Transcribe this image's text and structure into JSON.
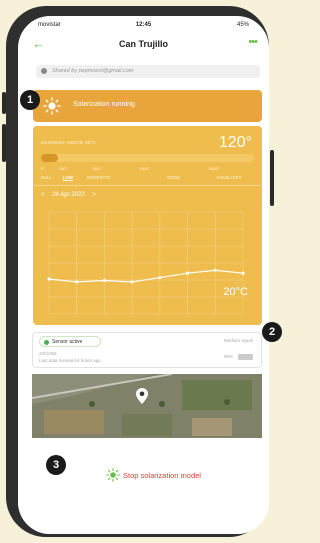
{
  "status_bar": {
    "carrier": "movistar",
    "time": "12:45",
    "battery": "45%"
  },
  "header": {
    "title": "Can Trujillo"
  },
  "shared": {
    "text": "Shared by pepmoeni@gmail.com"
  },
  "banner": {
    "text": "Solarization running"
  },
  "degrees": {
    "label": "DEGREES ABOVE 38ºC",
    "value": "120°",
    "progress": 0.08,
    "ticks": [
      "0°",
      "300°",
      "500°",
      "1000°",
      "3000°"
    ],
    "levels": [
      "NULL",
      "LOW",
      "MODERATE",
      "GOOD",
      "EXCELLENT"
    ],
    "active_level": "LOW"
  },
  "chart_nav": {
    "prev": "<",
    "date": "24 Apr 2022",
    "next": ">"
  },
  "chart_data": {
    "type": "line",
    "x": [
      1,
      2,
      3,
      4,
      5,
      6,
      7,
      8
    ],
    "y": [
      19.4,
      19.2,
      19.3,
      19.2,
      19.5,
      19.8,
      20.0,
      19.8
    ],
    "ylim": [
      17,
      24
    ],
    "current_label": "20°C"
  },
  "sensor": {
    "status": "Sensor active",
    "signal": "Medium signal",
    "id": "2002256",
    "last_data": "Last data received 8 hours ago",
    "battery": "90%"
  },
  "action": {
    "label": "Stop solarization model"
  },
  "callouts": [
    "1",
    "2",
    "3"
  ],
  "colors": {
    "accent": "#6cc04a",
    "banner": "#e8a53b",
    "panel": "#efbd4e",
    "stop": "#e53935"
  }
}
